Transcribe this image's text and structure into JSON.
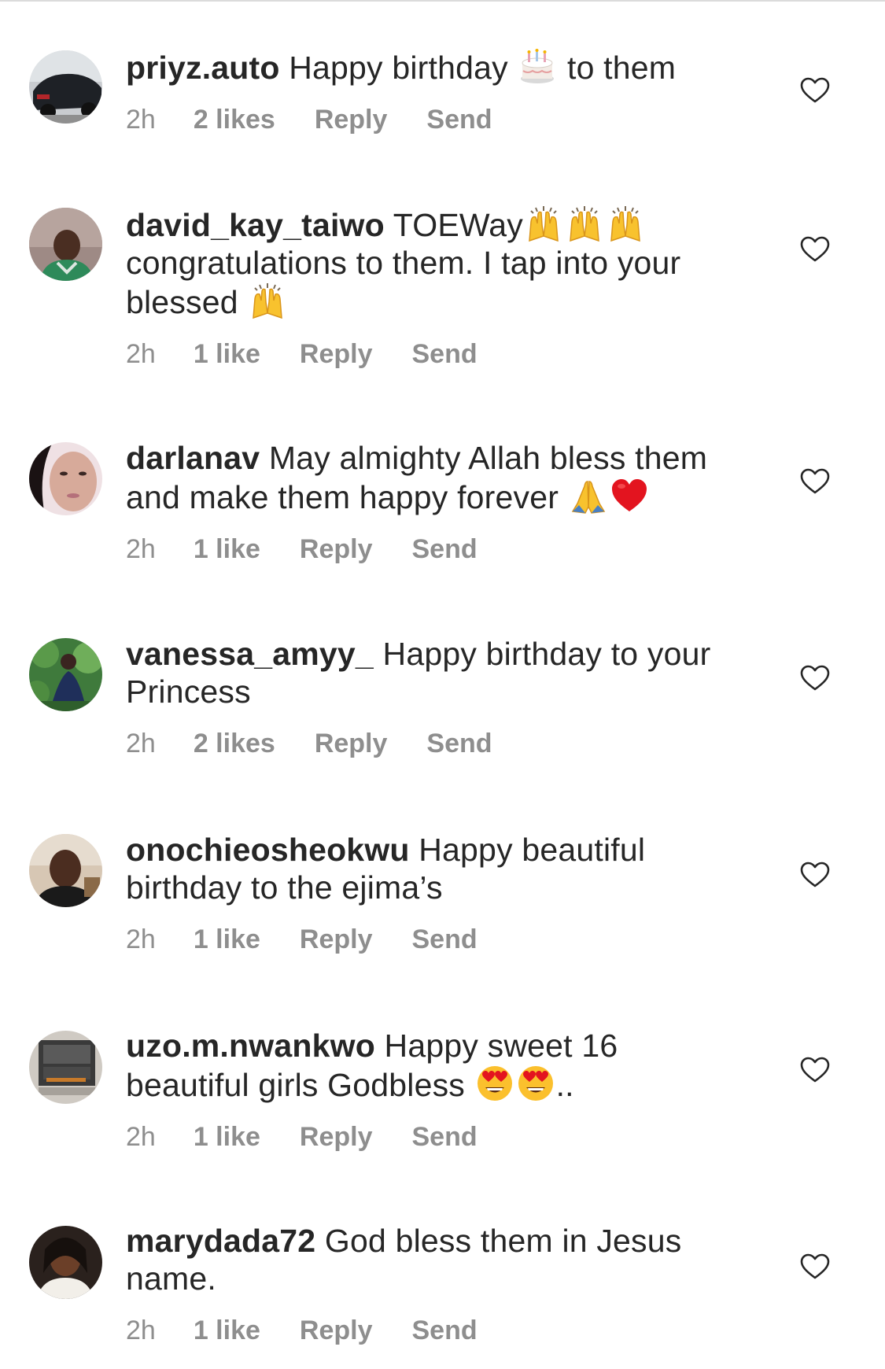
{
  "comments": [
    {
      "username": "priyz.auto",
      "text_before": " Happy birthday ",
      "text_after": " to them",
      "emojis": [
        "birthday-cake"
      ],
      "time": "2h",
      "likes": "2 likes",
      "reply": "Reply",
      "send": "Send"
    },
    {
      "username": "david_kay_taiwo",
      "text_line1": " TOEWay",
      "text_line2": "congratulations to them. I tap into your",
      "text_line3": "blessed ",
      "emojis": [
        "raising-hands",
        "raising-hands",
        "raising-hands",
        "raising-hands"
      ],
      "time": "2h",
      "likes": "1 like",
      "reply": "Reply",
      "send": "Send"
    },
    {
      "username": "darlanav",
      "text": " May almighty Allah bless them and make them happy forever ",
      "emojis": [
        "folded-hands",
        "red-heart"
      ],
      "time": "2h",
      "likes": "1 like",
      "reply": "Reply",
      "send": "Send"
    },
    {
      "username": "vanessa_amyy_",
      "text": " Happy birthday to your Princess",
      "time": "2h",
      "likes": "2 likes",
      "reply": "Reply",
      "send": "Send"
    },
    {
      "username": "onochieosheokwu",
      "text": " Happy beautiful birthday to the ejima’s",
      "time": "2h",
      "likes": "1 like",
      "reply": "Reply",
      "send": "Send"
    },
    {
      "username": "uzo.m.nwankwo",
      "text_before": " Happy sweet 16 beautiful girls Godbless ",
      "text_after": "..",
      "emojis": [
        "heart-eyes",
        "heart-eyes"
      ],
      "time": "2h",
      "likes": "1 like",
      "reply": "Reply",
      "send": "Send"
    },
    {
      "username": "marydada72",
      "text": " God bless them in Jesus name.",
      "time": "2h",
      "likes": "1 like",
      "reply": "Reply",
      "send": "Send"
    }
  ],
  "colors": {
    "text": "#262626",
    "meta": "#8e8e8e",
    "divider": "#dbdbdb"
  },
  "icons": {
    "like": "heart-outline-icon"
  }
}
